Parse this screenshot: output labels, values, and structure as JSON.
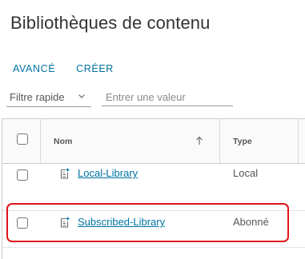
{
  "page": {
    "title": "Bibliothèques de contenu"
  },
  "actions": {
    "avance_label": "AVANCÉ",
    "creer_label": "CRÉER"
  },
  "filter": {
    "selected": "Filtre rapide",
    "input_placeholder": "Entrer une valeur",
    "input_value": ""
  },
  "table": {
    "columns": {
      "name": "Nom",
      "type": "Type"
    },
    "sort": {
      "column": "Nom",
      "direction": "ascending"
    },
    "rows": [
      {
        "name": "Local-Library",
        "type": "Local",
        "icon": "content-library-icon"
      },
      {
        "name": "Subscribed-Library",
        "type": "Abonné",
        "icon": "content-library-icon",
        "highlighted": true
      }
    ]
  },
  "colors": {
    "accent": "#0072a3",
    "highlight": "#e0141a"
  }
}
